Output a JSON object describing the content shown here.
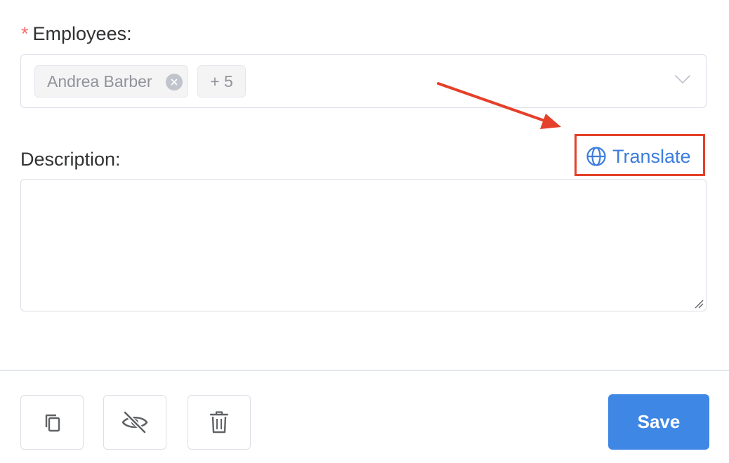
{
  "employees": {
    "required_mark": "*",
    "label": "Employees:",
    "selected_tag": "Andrea Barber",
    "more_count": "+ 5"
  },
  "description": {
    "label": "Description:",
    "value": "",
    "translate_label": "Translate"
  },
  "footer": {
    "save_label": "Save"
  },
  "colors": {
    "primary": "#3f87e5",
    "link": "#3b7ddd",
    "annotation": "#e5402a",
    "required": "#f56c6c"
  },
  "icons": [
    "close-icon",
    "chevron-down-icon",
    "globe-icon",
    "copy-icon",
    "eye-off-icon",
    "trash-icon"
  ]
}
